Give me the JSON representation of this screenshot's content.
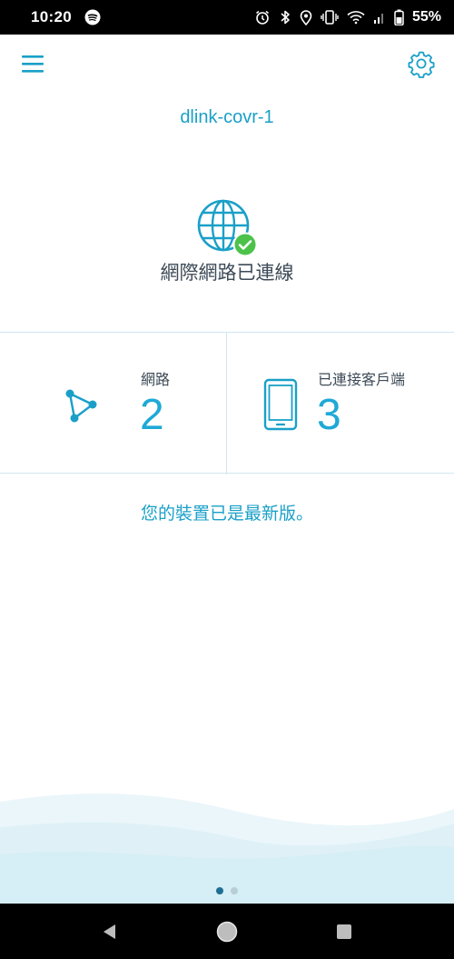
{
  "status_bar": {
    "time": "10:20",
    "battery": "55%",
    "icons": [
      "spotify-icon",
      "alarm-icon",
      "bluetooth-icon",
      "location-icon",
      "vibrate-icon",
      "wifi-icon",
      "signal-icon",
      "battery-icon"
    ]
  },
  "app_bar": {
    "menu_icon": "hamburger-menu-icon",
    "settings_icon": "gear-icon"
  },
  "device": {
    "name": "dlink-covr-1",
    "internet_status": "網際網路已連線"
  },
  "stats": {
    "networks": {
      "label": "網路",
      "value": "2",
      "icon": "network-nodes-icon"
    },
    "clients": {
      "label": "已連接客戶端",
      "value": "3",
      "icon": "phone-icon"
    }
  },
  "update_status": "您的裝置已是最新版。",
  "pager": {
    "current": 1,
    "total": 2
  },
  "colors": {
    "accent": "#1fa9d6",
    "text": "#3d4a57",
    "success": "#4cc24a",
    "divider": "#cfe7ef"
  }
}
